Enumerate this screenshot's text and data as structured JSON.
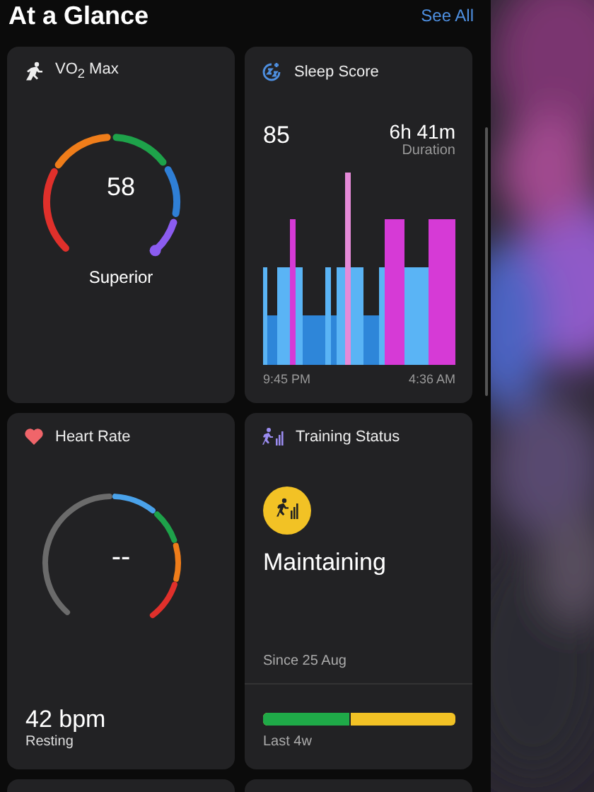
{
  "header": {
    "title": "At a Glance",
    "link": "See All"
  },
  "vo2": {
    "title": "VO$_{2}$ Max",
    "value": "58",
    "rating": "Superior"
  },
  "sleep": {
    "title": "Sleep Score",
    "score": "85",
    "duration": "6h 41m",
    "duration_label": "Duration",
    "start": "9:45 PM",
    "end": "4:36 AM"
  },
  "heart": {
    "title": "Heart Rate",
    "value": "--",
    "resting": "42 bpm",
    "resting_label": "Resting"
  },
  "training": {
    "title": "Training Status",
    "status": "Maintaining",
    "since": "Since 25 Aug",
    "level": 0.45,
    "period": "Last 4w"
  }
}
